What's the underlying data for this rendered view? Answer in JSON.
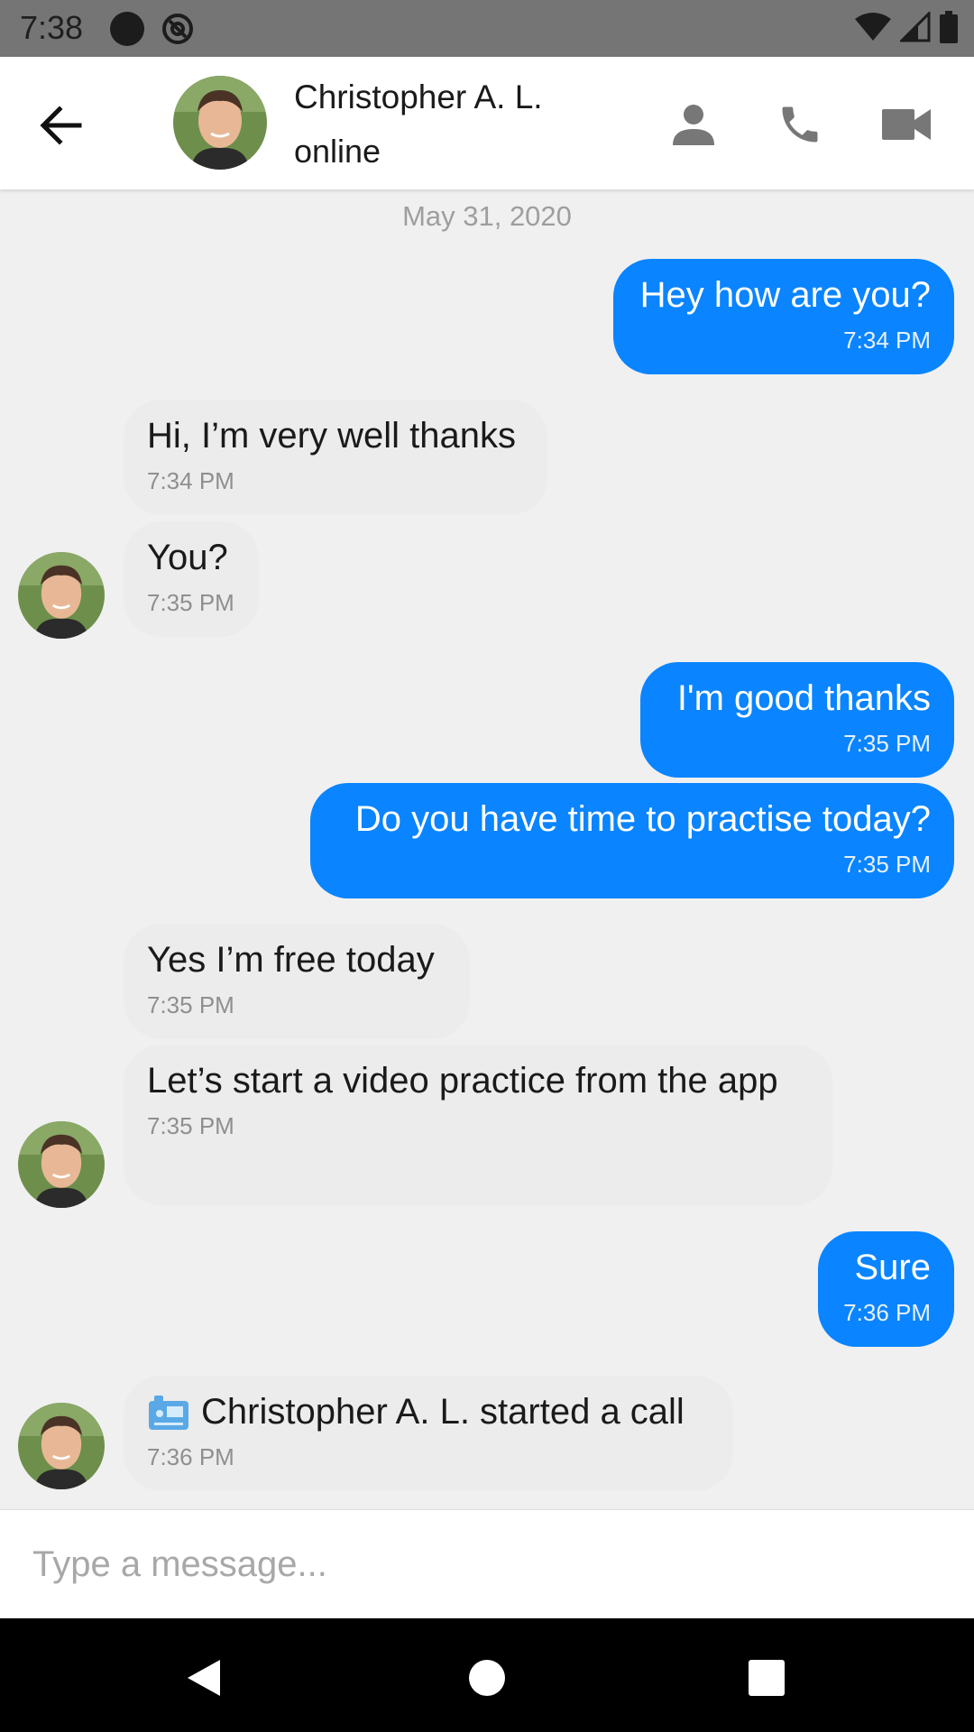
{
  "status_bar": {
    "time": "7:38"
  },
  "header": {
    "name": "Christopher A. L.",
    "status": "online"
  },
  "date_separator": "May 31, 2020",
  "messages": [
    {
      "text": "Hey how are you?",
      "time": "7:34 PM"
    },
    {
      "text": "Hi, I’m very well thanks",
      "time": "7:34 PM"
    },
    {
      "text": "You?",
      "time": "7:35 PM"
    },
    {
      "text": "I'm good thanks",
      "time": "7:35 PM"
    },
    {
      "text": "Do you have time to practise today?",
      "time": "7:35 PM"
    },
    {
      "text": "Yes I’m free today",
      "time": "7:35 PM"
    },
    {
      "text": "Let’s start a video practice from the app",
      "time": "7:35 PM"
    },
    {
      "text": "Sure",
      "time": "7:36 PM"
    },
    {
      "text": "Christopher A. L. started a call",
      "time": "7:36 PM",
      "icon": "video-camera-icon"
    }
  ],
  "composer": {
    "placeholder": "Type a message..."
  },
  "colors": {
    "outgoing_bubble": "#0a84ff",
    "incoming_bubble": "#ececec",
    "background": "#f0f0f0"
  }
}
